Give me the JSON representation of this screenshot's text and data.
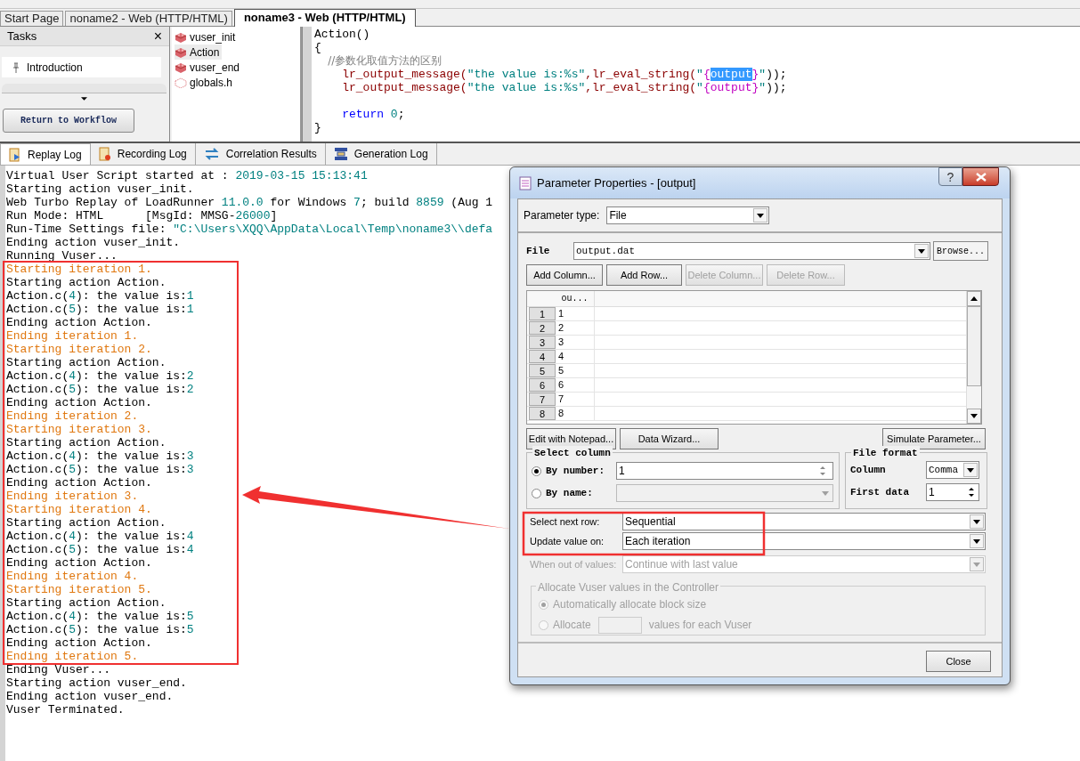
{
  "document_tabs": [
    {
      "label": "Start Page",
      "selected": false
    },
    {
      "label": "noname2 - Web (HTTP/HTML)",
      "selected": false
    },
    {
      "label": "noname3 - Web (HTTP/HTML)",
      "selected": true
    }
  ],
  "tasks_panel": {
    "title": "Tasks",
    "close": "×",
    "items": [
      {
        "label": "Introduction"
      }
    ],
    "button": "Return to Workflow"
  },
  "script_tree": [
    {
      "label": "vuser_init",
      "kind": "action",
      "selected": false
    },
    {
      "label": "Action",
      "kind": "action",
      "selected": true
    },
    {
      "label": "vuser_end",
      "kind": "action",
      "selected": false
    },
    {
      "label": "globals.h",
      "kind": "header",
      "selected": false
    }
  ],
  "editor": {
    "lines": [
      {
        "segments": [
          {
            "text": "Action()",
            "kind": "plain"
          }
        ]
      },
      {
        "segments": [
          {
            "text": "{",
            "kind": "plain"
          }
        ]
      },
      {
        "segments": [
          {
            "text": "    //参数化取值方法的区别",
            "kind": "comment"
          }
        ]
      },
      {
        "segments": [
          {
            "text": "    lr_output_message(",
            "kind": "func"
          },
          {
            "text": "\"the value is:%s\"",
            "kind": "string"
          },
          {
            "text": ",lr_eval_string(",
            "kind": "func"
          },
          {
            "text": "\"",
            "kind": "string"
          },
          {
            "text": "{",
            "kind": "param"
          },
          {
            "text": "output",
            "kind": "selected"
          },
          {
            "text": "}",
            "kind": "param"
          },
          {
            "text": "\"",
            "kind": "string"
          },
          {
            "text": "));",
            "kind": "plain"
          }
        ]
      },
      {
        "segments": [
          {
            "text": "    lr_output_message(",
            "kind": "func"
          },
          {
            "text": "\"the value is:%s\"",
            "kind": "string"
          },
          {
            "text": ",lr_eval_string(",
            "kind": "func"
          },
          {
            "text": "\"",
            "kind": "string"
          },
          {
            "text": "{output}",
            "kind": "param"
          },
          {
            "text": "\"",
            "kind": "string"
          },
          {
            "text": "));",
            "kind": "plain"
          }
        ]
      },
      {
        "kind": "blank"
      },
      {
        "segments": [
          {
            "text": "    return",
            "kind": "keyword"
          },
          {
            "text": " 0",
            "kind": "number"
          },
          {
            "text": ";",
            "kind": "plain"
          }
        ]
      },
      {
        "segments": [
          {
            "text": "}",
            "kind": "plain"
          }
        ]
      }
    ]
  },
  "log_tabs": [
    {
      "label": "Replay Log",
      "selected": true
    },
    {
      "label": "Recording Log",
      "selected": false
    },
    {
      "label": "Correlation Results",
      "selected": false
    },
    {
      "label": "Generation Log",
      "selected": false
    }
  ],
  "replay_log": [
    {
      "kind": "normal",
      "segments": [
        {
          "text": "Virtual User Script started at : ",
          "kind": "plain"
        },
        {
          "text": "2019-03-15 15:13:41",
          "kind": "value"
        }
      ]
    },
    {
      "kind": "normal",
      "segments": [
        {
          "text": "Starting action vuser_init.",
          "kind": "plain"
        }
      ]
    },
    {
      "kind": "normal",
      "segments": [
        {
          "text": "Web Turbo Replay of LoadRunner ",
          "kind": "plain"
        },
        {
          "text": "11.0.0",
          "kind": "value"
        },
        {
          "text": " for Windows ",
          "kind": "plain"
        },
        {
          "text": "7",
          "kind": "value"
        },
        {
          "text": "; build ",
          "kind": "plain"
        },
        {
          "text": "8859",
          "kind": "value"
        },
        {
          "text": " (Aug 1",
          "kind": "plain"
        }
      ]
    },
    {
      "kind": "normal",
      "segments": [
        {
          "text": "Run Mode: HTML      [MsgId: MMSG-",
          "kind": "plain"
        },
        {
          "text": "26000",
          "kind": "value"
        },
        {
          "text": "]",
          "kind": "plain"
        }
      ]
    },
    {
      "kind": "normal",
      "segments": [
        {
          "text": "Run-Time Settings file: ",
          "kind": "plain"
        },
        {
          "text": "\"C:\\Users\\XQQ\\AppData\\Local\\Temp\\noname3\\\\defa",
          "kind": "value"
        }
      ]
    },
    {
      "kind": "normal",
      "segments": [
        {
          "text": "Ending action vuser_init.",
          "kind": "plain"
        }
      ]
    },
    {
      "kind": "normal",
      "segments": [
        {
          "text": "Running Vuser...",
          "kind": "plain"
        }
      ]
    },
    {
      "kind": "iteration",
      "segments": [
        {
          "text": "Starting iteration 1.",
          "kind": "plain"
        }
      ]
    },
    {
      "kind": "normal",
      "segments": [
        {
          "text": "Starting action Action.",
          "kind": "plain"
        }
      ]
    },
    {
      "kind": "normal",
      "segments": [
        {
          "text": "Action.c(",
          "kind": "plain"
        },
        {
          "text": "4",
          "kind": "value"
        },
        {
          "text": "): the value is:",
          "kind": "plain"
        },
        {
          "text": "1",
          "kind": "value"
        }
      ]
    },
    {
      "kind": "normal",
      "segments": [
        {
          "text": "Action.c(",
          "kind": "plain"
        },
        {
          "text": "5",
          "kind": "value"
        },
        {
          "text": "): the value is:",
          "kind": "plain"
        },
        {
          "text": "1",
          "kind": "value"
        }
      ]
    },
    {
      "kind": "normal",
      "segments": [
        {
          "text": "Ending action Action.",
          "kind": "plain"
        }
      ]
    },
    {
      "kind": "iteration",
      "segments": [
        {
          "text": "Ending iteration 1.",
          "kind": "plain"
        }
      ]
    },
    {
      "kind": "iteration",
      "segments": [
        {
          "text": "Starting iteration 2.",
          "kind": "plain"
        }
      ]
    },
    {
      "kind": "normal",
      "segments": [
        {
          "text": "Starting action Action.",
          "kind": "plain"
        }
      ]
    },
    {
      "kind": "normal",
      "segments": [
        {
          "text": "Action.c(",
          "kind": "plain"
        },
        {
          "text": "4",
          "kind": "value"
        },
        {
          "text": "): the value is:",
          "kind": "plain"
        },
        {
          "text": "2",
          "kind": "value"
        }
      ]
    },
    {
      "kind": "normal",
      "segments": [
        {
          "text": "Action.c(",
          "kind": "plain"
        },
        {
          "text": "5",
          "kind": "value"
        },
        {
          "text": "): the value is:",
          "kind": "plain"
        },
        {
          "text": "2",
          "kind": "value"
        }
      ]
    },
    {
      "kind": "normal",
      "segments": [
        {
          "text": "Ending action Action.",
          "kind": "plain"
        }
      ]
    },
    {
      "kind": "iteration",
      "segments": [
        {
          "text": "Ending iteration 2.",
          "kind": "plain"
        }
      ]
    },
    {
      "kind": "iteration",
      "segments": [
        {
          "text": "Starting iteration 3.",
          "kind": "plain"
        }
      ]
    },
    {
      "kind": "normal",
      "segments": [
        {
          "text": "Starting action Action.",
          "kind": "plain"
        }
      ]
    },
    {
      "kind": "normal",
      "segments": [
        {
          "text": "Action.c(",
          "kind": "plain"
        },
        {
          "text": "4",
          "kind": "value"
        },
        {
          "text": "): the value is:",
          "kind": "plain"
        },
        {
          "text": "3",
          "kind": "value"
        }
      ]
    },
    {
      "kind": "normal",
      "segments": [
        {
          "text": "Action.c(",
          "kind": "plain"
        },
        {
          "text": "5",
          "kind": "value"
        },
        {
          "text": "): the value is:",
          "kind": "plain"
        },
        {
          "text": "3",
          "kind": "value"
        }
      ]
    },
    {
      "kind": "normal",
      "segments": [
        {
          "text": "Ending action Action.",
          "kind": "plain"
        }
      ]
    },
    {
      "kind": "iteration",
      "segments": [
        {
          "text": "Ending iteration 3.",
          "kind": "plain"
        }
      ]
    },
    {
      "kind": "iteration",
      "segments": [
        {
          "text": "Starting iteration 4.",
          "kind": "plain"
        }
      ]
    },
    {
      "kind": "normal",
      "segments": [
        {
          "text": "Starting action Action.",
          "kind": "plain"
        }
      ]
    },
    {
      "kind": "normal",
      "segments": [
        {
          "text": "Action.c(",
          "kind": "plain"
        },
        {
          "text": "4",
          "kind": "value"
        },
        {
          "text": "): the value is:",
          "kind": "plain"
        },
        {
          "text": "4",
          "kind": "value"
        }
      ]
    },
    {
      "kind": "normal",
      "segments": [
        {
          "text": "Action.c(",
          "kind": "plain"
        },
        {
          "text": "5",
          "kind": "value"
        },
        {
          "text": "): the value is:",
          "kind": "plain"
        },
        {
          "text": "4",
          "kind": "value"
        }
      ]
    },
    {
      "kind": "normal",
      "segments": [
        {
          "text": "Ending action Action.",
          "kind": "plain"
        }
      ]
    },
    {
      "kind": "iteration",
      "segments": [
        {
          "text": "Ending iteration 4.",
          "kind": "plain"
        }
      ]
    },
    {
      "kind": "iteration",
      "segments": [
        {
          "text": "Starting iteration 5.",
          "kind": "plain"
        }
      ]
    },
    {
      "kind": "normal",
      "segments": [
        {
          "text": "Starting action Action.",
          "kind": "plain"
        }
      ]
    },
    {
      "kind": "normal",
      "segments": [
        {
          "text": "Action.c(",
          "kind": "plain"
        },
        {
          "text": "4",
          "kind": "value"
        },
        {
          "text": "): the value is:",
          "kind": "plain"
        },
        {
          "text": "5",
          "kind": "value"
        }
      ]
    },
    {
      "kind": "normal",
      "segments": [
        {
          "text": "Action.c(",
          "kind": "plain"
        },
        {
          "text": "5",
          "kind": "value"
        },
        {
          "text": "): the value is:",
          "kind": "plain"
        },
        {
          "text": "5",
          "kind": "value"
        }
      ]
    },
    {
      "kind": "normal",
      "segments": [
        {
          "text": "Ending action Action.",
          "kind": "plain"
        }
      ]
    },
    {
      "kind": "iteration",
      "segments": [
        {
          "text": "Ending iteration 5.",
          "kind": "plain"
        }
      ]
    },
    {
      "kind": "normal",
      "segments": [
        {
          "text": "Ending Vuser...",
          "kind": "plain"
        }
      ]
    },
    {
      "kind": "normal",
      "segments": [
        {
          "text": "Starting action vuser_end.",
          "kind": "plain"
        }
      ]
    },
    {
      "kind": "normal",
      "segments": [
        {
          "text": "Ending action vuser_end.",
          "kind": "plain"
        }
      ]
    },
    {
      "kind": "normal",
      "segments": [
        {
          "text": "Vuser Terminated.",
          "kind": "plain"
        }
      ]
    }
  ],
  "dialog": {
    "title": "Parameter Properties - [output]",
    "help_button": "?",
    "parameter_type": {
      "label": "Parameter type:",
      "value": "File"
    },
    "file": {
      "label": "File",
      "value": "output.dat",
      "browse": "Browse..."
    },
    "table_buttons": [
      {
        "label": "Add Column...",
        "disabled": false
      },
      {
        "label": "Add Row...",
        "disabled": false
      },
      {
        "label": "Delete Column...",
        "disabled": true
      },
      {
        "label": "Delete Row...",
        "disabled": true
      }
    ],
    "table": {
      "columns": [
        "ou..."
      ],
      "rows": [
        {
          "number": "1",
          "cells": [
            "1"
          ]
        },
        {
          "number": "2",
          "cells": [
            "2"
          ]
        },
        {
          "number": "3",
          "cells": [
            "3"
          ]
        },
        {
          "number": "4",
          "cells": [
            "4"
          ]
        },
        {
          "number": "5",
          "cells": [
            "5"
          ]
        },
        {
          "number": "6",
          "cells": [
            "6"
          ]
        },
        {
          "number": "7",
          "cells": [
            "7"
          ]
        },
        {
          "number": "8",
          "cells": [
            "8"
          ]
        }
      ]
    },
    "action_buttons": [
      {
        "label": "Edit with Notepad..."
      },
      {
        "label": "Data Wizard..."
      },
      {
        "label": "Simulate Parameter..."
      }
    ],
    "select_column": {
      "title": "Select column",
      "options": [
        {
          "label": "By number:",
          "selected": true,
          "value": "1",
          "disabled": false
        },
        {
          "label": "By name:",
          "selected": false,
          "disabled": true
        }
      ]
    },
    "file_format": {
      "title": "File format",
      "column": {
        "label": "Column",
        "value": "Comma"
      },
      "first_data": {
        "label": "First data",
        "value": "1"
      }
    },
    "select_next_row": {
      "label": "Select next row:",
      "value": "Sequential"
    },
    "update_value_on": {
      "label": "Update value on:",
      "value": "Each iteration"
    },
    "when_out_of_values": {
      "label": "When out of values:",
      "value": "Continue with last value",
      "disabled": true
    },
    "allocate": {
      "title": "Allocate Vuser values in the Controller",
      "disabled": true,
      "options": [
        {
          "label": "Automatically allocate block size",
          "selected": true
        },
        {
          "label": "Allocate",
          "suffix": "values for each Vuser",
          "selected": false
        }
      ]
    },
    "close_button": "Close"
  }
}
